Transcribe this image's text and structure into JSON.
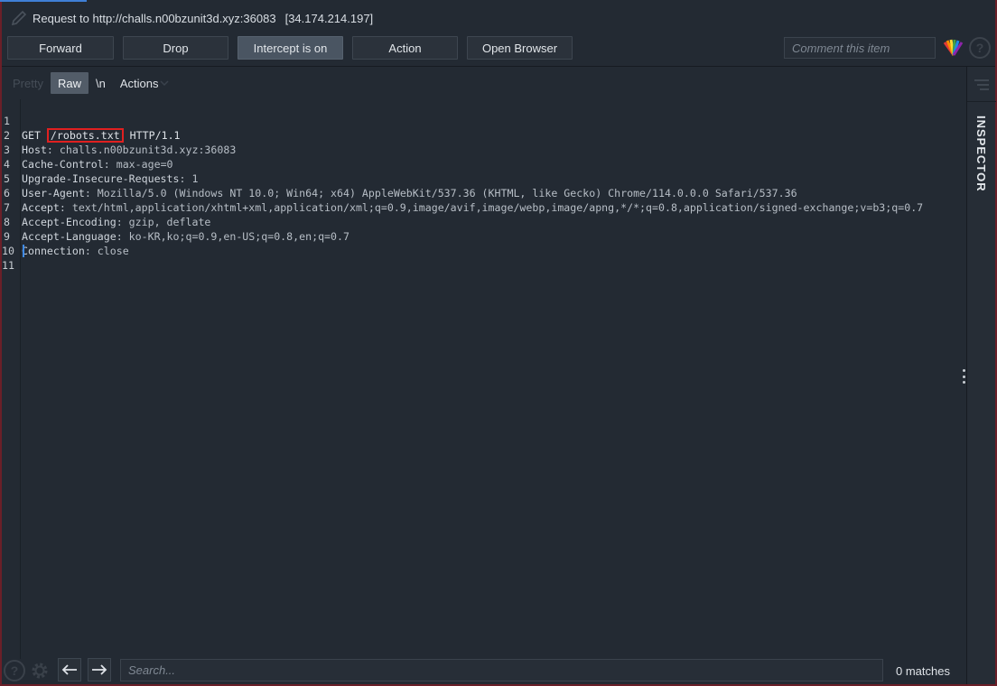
{
  "window": {
    "title": "Request to http://challs.n00bzunit3d.xyz:36083",
    "ip": "[34.174.214.197]"
  },
  "toolbar": {
    "forward": "Forward",
    "drop": "Drop",
    "intercept": "Intercept is on",
    "action": "Action",
    "open_browser": "Open Browser",
    "comment_placeholder": "Comment this item"
  },
  "editor_tabs": {
    "pretty": "Pretty",
    "raw": "Raw",
    "newline": "\\n",
    "actions": "Actions"
  },
  "request": {
    "line1": {
      "num": "1",
      "method": "GET ",
      "path": "/robots.txt",
      "version": " HTTP/1.1"
    },
    "headers": [
      {
        "num": "2",
        "name": "Host",
        "value": ": challs.n00bzunit3d.xyz:36083"
      },
      {
        "num": "3",
        "name": "Cache-Control",
        "value": ": max-age=0"
      },
      {
        "num": "4",
        "name": "Upgrade-Insecure-Requests",
        "value": ": 1"
      },
      {
        "num": "5",
        "name": "User-Agent",
        "value": ": Mozilla/5.0 (Windows NT 10.0; Win64; x64) AppleWebKit/537.36 (KHTML, like Gecko) Chrome/114.0.0.0 Safari/537.36"
      },
      {
        "num": "6",
        "name": "Accept",
        "value": ": text/html,application/xhtml+xml,application/xml;q=0.9,image/avif,image/webp,image/apng,*/*;q=0.8,application/signed-exchange;v=b3;q=0.7"
      },
      {
        "num": "7",
        "name": "Accept-Encoding",
        "value": ": gzip, deflate"
      },
      {
        "num": "8",
        "name": "Accept-Language",
        "value": ": ko-KR,ko;q=0.9,en-US;q=0.8,en;q=0.7"
      },
      {
        "num": "9",
        "name": "Connection",
        "value": ": close"
      }
    ],
    "line10": "10",
    "line11": "11"
  },
  "inspector": {
    "label": "INSPECTOR"
  },
  "search": {
    "placeholder": "Search...",
    "matches": "0 matches"
  }
}
